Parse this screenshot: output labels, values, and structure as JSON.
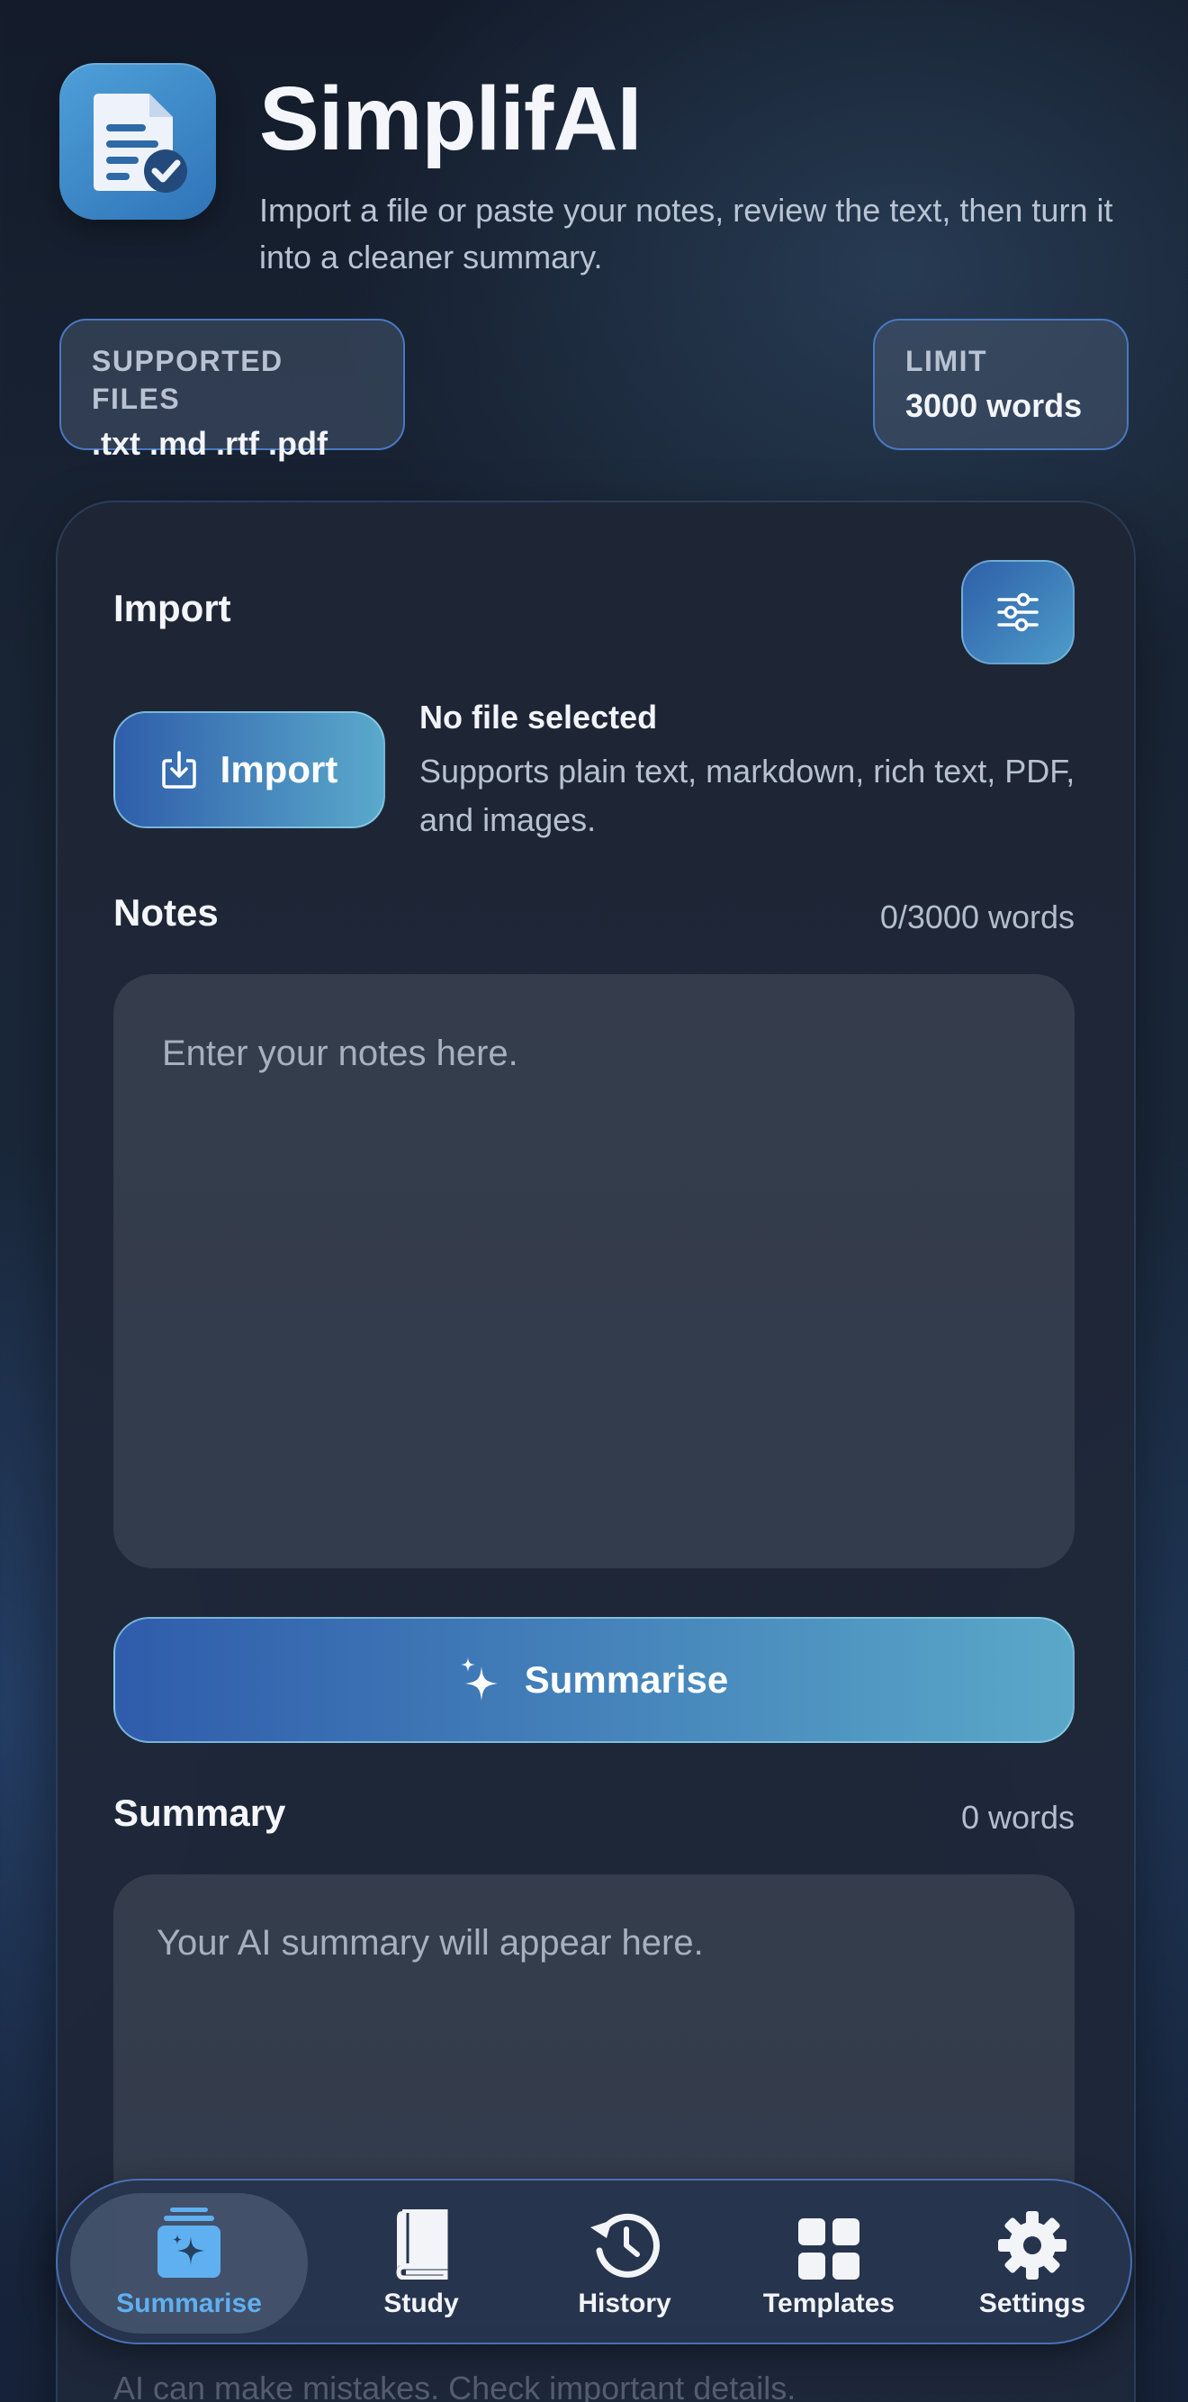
{
  "header": {
    "title": "SimplifAI",
    "subtitle": "Import a file or paste your notes, review the text, then turn it into a cleaner summary."
  },
  "chips": {
    "files_label": "SUPPORTED FILES",
    "files_value": ".txt .md .rtf .pdf",
    "limit_label": "LIMIT",
    "limit_value": "3000 words"
  },
  "import": {
    "section_title": "Import",
    "button_label": "Import",
    "file_status": "No file selected",
    "file_help": "Supports plain text, markdown, rich text, PDF, and images."
  },
  "notes": {
    "section_title": "Notes",
    "word_count": "0/3000 words",
    "placeholder": "Enter your notes here."
  },
  "summarise": {
    "button_label": "Summarise"
  },
  "summary": {
    "section_title": "Summary",
    "word_count": "0 words",
    "placeholder": "Your AI summary will appear here."
  },
  "tabs": [
    {
      "label": "Summarise",
      "icon": "summarise-icon",
      "active": true
    },
    {
      "label": "Study",
      "icon": "book-icon",
      "active": false
    },
    {
      "label": "History",
      "icon": "history-icon",
      "active": false
    },
    {
      "label": "Templates",
      "icon": "grid-icon",
      "active": false
    },
    {
      "label": "Settings",
      "icon": "gear-icon",
      "active": false
    }
  ],
  "disclaimer": "AI can make mistakes. Check important details.",
  "colors": {
    "accent": "#5fb0f0",
    "button_gradient_start": "#2f5cab",
    "button_gradient_end": "#5aa8c9",
    "background": "#1a2637"
  }
}
